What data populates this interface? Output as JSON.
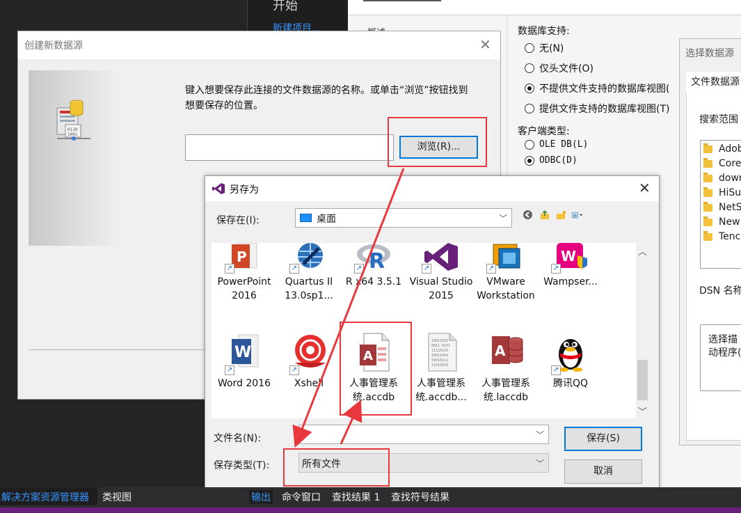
{
  "ide": {
    "start_heading": "开始",
    "new_project": "新建项目...",
    "overview": "概述"
  },
  "db_support": {
    "label": "数据库支持:",
    "options": [
      "无(N)",
      "仅头文件(O)",
      "不提供文件支持的数据库视图(",
      "提供文件支持的数据库视图(T)"
    ],
    "selected_index": 2
  },
  "client_type": {
    "label": "客户端类型:",
    "options": [
      "OLE DB(L)",
      "ODBC(D)"
    ],
    "selected_index": 1
  },
  "select_dsn": {
    "title": "选择数据源",
    "tab": "文件数据源",
    "search_label": "搜索范围",
    "folders": [
      "Adob",
      "Core",
      "dowr",
      "HiSu",
      "NetS",
      "New",
      "Tenc"
    ],
    "dsn_label": "DSN 名称",
    "desc_lines": [
      "选择描",
      "动程序("
    ]
  },
  "create_dsn": {
    "title": "创建新数据源",
    "instruction": "键入想要保存此连接的文件数据源的名称。或单击“浏览”按钮找到想要保存的位置。",
    "name_value": "",
    "browse": "浏览(R)..."
  },
  "save_as": {
    "title": "另存为",
    "save_in_label": "保存在(I):",
    "save_in_value": "桌面",
    "files": [
      {
        "label": "PowerPoint 2016",
        "icon": "powerpoint-icon"
      },
      {
        "label": "Quartus II 13.0sp1...",
        "icon": "quartus-icon"
      },
      {
        "label": "R x64 3.5.1",
        "icon": "r-icon"
      },
      {
        "label": "Visual Studio 2015",
        "icon": "visual-studio-icon"
      },
      {
        "label": "VMware Workstation",
        "icon": "vmware-icon"
      },
      {
        "label": "Wampser...",
        "icon": "wampserver-icon"
      },
      {
        "label": "Word 2016",
        "icon": "word-icon"
      },
      {
        "label": "Xshell",
        "icon": "xshell-icon"
      },
      {
        "label": "人事管理系统.accdb",
        "icon": "access-icon"
      },
      {
        "label": "人事管理系统.accdb...",
        "icon": "binary-file-icon"
      },
      {
        "label": "人事管理系统.laccdb",
        "icon": "access-lock-icon"
      },
      {
        "label": "腾讯QQ",
        "icon": "qq-icon"
      }
    ],
    "filename_label": "文件名(N):",
    "filename_value": "",
    "filetype_label": "保存类型(T):",
    "filetype_value": "所有文件",
    "save_btn": "保存(S)",
    "cancel_btn": "取消"
  },
  "bottom": {
    "solution_explorer": "解决方案资源管理器",
    "class_view": "类视图",
    "output": "输出",
    "command_window": "命令窗口",
    "find_results": "查找结果 1",
    "find_symbol": "查找符号结果"
  },
  "colors": {
    "annotation_red": "#e8383d",
    "accent_blue": "#0078d7",
    "vs_purple": "#68217a"
  }
}
